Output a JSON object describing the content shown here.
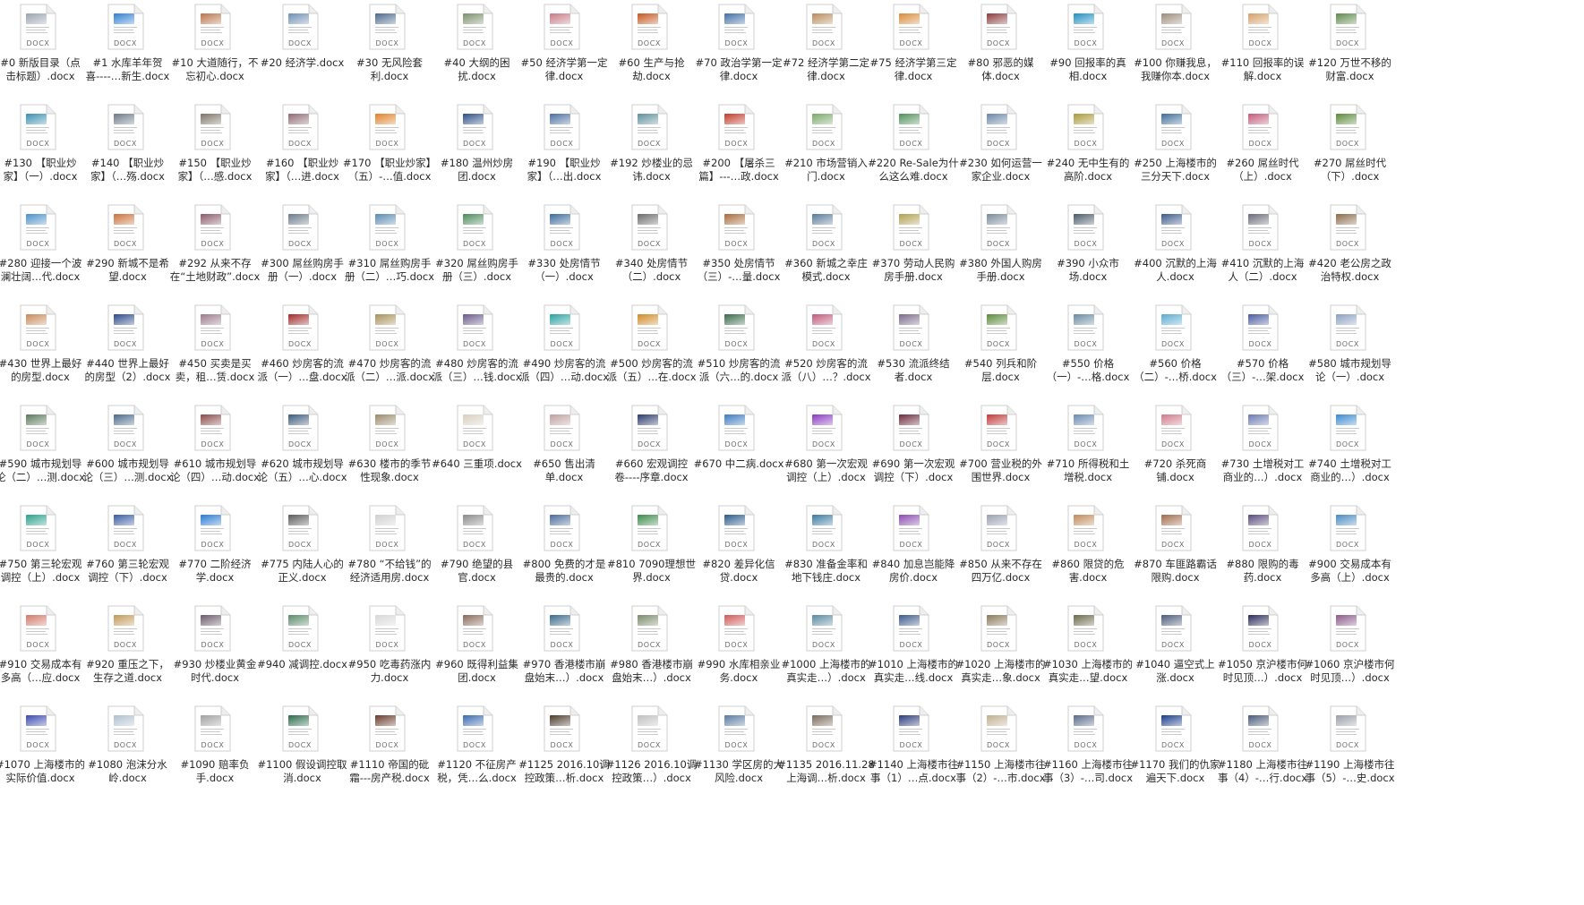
{
  "file_type_label": "DOCX",
  "files": [
    {
      "name": "#0 新版目录（点击标题）.docx",
      "l1": "#0 新版目录（点",
      "l2": "击标题）.docx",
      "thumb": "#9aa4b0"
    },
    {
      "name": "#1 水库羊年贺喜----…新生.docx",
      "l1": "#1 水库羊年贺",
      "l2": "喜----…新生.docx",
      "thumb": "#2f7fd1"
    },
    {
      "name": "#10 大道随行，不忘初心.docx",
      "l1": "#10 大道随行，不",
      "l2": "忘初心.docx",
      "thumb": "#b9754a"
    },
    {
      "name": "#20 经济学.docx",
      "l1": "#20 经济学.docx",
      "l2": "",
      "thumb": "#6f8fb4"
    },
    {
      "name": "#30 无风险套利.docx",
      "l1": "#30 无风险套",
      "l2": "利.docx",
      "thumb": "#4c6a8c"
    },
    {
      "name": "#40 大纲的困扰.docx",
      "l1": "#40 大纲的困",
      "l2": "扰.docx",
      "thumb": "#7a8f6a"
    },
    {
      "name": "#50 经济学第一定律.docx",
      "l1": "#50 经济学第一定",
      "l2": "律.docx",
      "thumb": "#c77a86"
    },
    {
      "name": "#60 生产与抢劫.docx",
      "l1": "#60 生产与抢",
      "l2": "劫.docx",
      "thumb": "#c4571f"
    },
    {
      "name": "#70 政治学第一定律.docx",
      "l1": "#70 政治学第一定",
      "l2": "律.docx",
      "thumb": "#3f6ea6"
    },
    {
      "name": "#72 经济学第二定律.docx",
      "l1": "#72 经济学第二定",
      "l2": "律.docx",
      "thumb": "#b88c5c"
    },
    {
      "name": "#75 经济学第三定律.docx",
      "l1": "#75 经济学第三定",
      "l2": "律.docx",
      "thumb": "#d98a3a"
    },
    {
      "name": "#80 邪恶的媒体.docx",
      "l1": "#80 邪恶的媒",
      "l2": "体.docx",
      "thumb": "#8c3b3b"
    },
    {
      "name": "#90 回报率的真相.docx",
      "l1": "#90 回报率的真",
      "l2": "相.docx",
      "thumb": "#1f8fc2"
    },
    {
      "name": "#100 你赚我息，我赚你本.docx",
      "l1": "#100 你赚我息，",
      "l2": "我赚你本.docx",
      "thumb": "#9c8c7a"
    },
    {
      "name": "#110 回报率的误解.docx",
      "l1": "#110 回报率的误",
      "l2": "解.docx",
      "thumb": "#d4a06a"
    },
    {
      "name": "#120 万世不移的财富.docx",
      "l1": "#120 万世不移的",
      "l2": "财富.docx",
      "thumb": "#5c8a4a"
    },
    {
      "name": "#130 【职业炒家】（一）.docx",
      "l1": "#130 【职业炒",
      "l2": "家】（一）.docx",
      "thumb": "#3a8fb0"
    },
    {
      "name": "#140 【职业炒家】（…殇.docx",
      "l1": "#140 【职业炒",
      "l2": "家】（…殇.docx",
      "thumb": "#6d7a88"
    },
    {
      "name": "#150 【职业炒家】（…感.docx",
      "l1": "#150 【职业炒",
      "l2": "家】（…感.docx",
      "thumb": "#7c7468"
    },
    {
      "name": "#160 【职业炒家】（…进.docx",
      "l1": "#160 【职业炒",
      "l2": "家】（…进.docx",
      "thumb": "#8f6a74"
    },
    {
      "name": "#170 【职业炒家】（五）-…值.docx",
      "l1": "#170 【职业炒家】",
      "l2": "（五）-…值.docx",
      "thumb": "#e0822a"
    },
    {
      "name": "#180 温州炒房团.docx",
      "l1": "#180 温州炒房",
      "l2": "团.docx",
      "thumb": "#2d4f86"
    },
    {
      "name": "#190 【职业炒家】（…出.docx",
      "l1": "#190 【职业炒",
      "l2": "家】（…出.docx",
      "thumb": "#4a6fa0"
    },
    {
      "name": "#192 炒楼业的忌讳.docx",
      "l1": "#192 炒楼业的忌",
      "l2": "讳.docx",
      "thumb": "#5d8f9a"
    },
    {
      "name": "#200 【屠杀三篇】---…政.docx",
      "l1": "#200 【屠杀三",
      "l2": "篇】---…政.docx",
      "thumb": "#c23a2a"
    },
    {
      "name": "#210 市场营销入门.docx",
      "l1": "#210 市场营销入",
      "l2": "门.docx",
      "thumb": "#7aa86a"
    },
    {
      "name": "#220 Re-Sale为什么这么难.docx",
      "l1": "#220 Re-Sale为什",
      "l2": "么这么难.docx",
      "thumb": "#4f8f5a"
    },
    {
      "name": "#230 如何运营一家企业.docx",
      "l1": "#230 如何运营一",
      "l2": "家企业.docx",
      "thumb": "#6b86a8"
    },
    {
      "name": "#240 无中生有的高阶.docx",
      "l1": "#240 无中生有的",
      "l2": "高阶.docx",
      "thumb": "#a89a3a"
    },
    {
      "name": "#250 上海楼市的三分天下.docx",
      "l1": "#250 上海楼市的",
      "l2": "三分天下.docx",
      "thumb": "#3d6d9a"
    },
    {
      "name": "#260 屌丝时代（上）.docx",
      "l1": "#260 屌丝时代",
      "l2": "（上）.docx",
      "thumb": "#c25a7a"
    },
    {
      "name": "#270 屌丝时代（下）.docx",
      "l1": "#270 屌丝时代",
      "l2": "（下）.docx",
      "thumb": "#5a8a3a"
    },
    {
      "name": "#280 迎接一个波澜壮阔…代.docx",
      "l1": "#280 迎接一个波",
      "l2": "澜壮阔…代.docx",
      "thumb": "#4a90c8"
    },
    {
      "name": "#290 新城不是希望.docx",
      "l1": "#290 新城不是希",
      "l2": "望.docx",
      "thumb": "#c9713a"
    },
    {
      "name": "#292 从来不存在“土地财政”.docx",
      "l1": "#292 从来不存",
      "l2": "在“土地财政”.docx",
      "thumb": "#8a5a6a"
    },
    {
      "name": "#300 屌丝购房手册（一）.docx",
      "l1": "#300 屌丝购房手",
      "l2": "册（一）.docx",
      "thumb": "#6a7a8a"
    },
    {
      "name": "#310 屌丝购房手册（二）…巧.docx",
      "l1": "#310 屌丝购房手",
      "l2": "册（二）…巧.docx",
      "thumb": "#5a8ab0"
    },
    {
      "name": "#320 屌丝购房手册（三）.docx",
      "l1": "#320 屌丝购房手",
      "l2": "册（三）.docx",
      "thumb": "#4a8a5a"
    },
    {
      "name": "#330 处房情节（一）.docx",
      "l1": "#330 处房情节",
      "l2": "（一）.docx",
      "thumb": "#3a6a9a"
    },
    {
      "name": "#340 处房情节（二）.docx",
      "l1": "#340 处房情节",
      "l2": "（二）.docx",
      "thumb": "#6a6a6a"
    },
    {
      "name": "#350 处房情节（三）-…量.docx",
      "l1": "#350 处房情节",
      "l2": "（三）-…量.docx",
      "thumb": "#a86a3a"
    },
    {
      "name": "#360 新城之幸庄模式.docx",
      "l1": "#360 新城之幸庄",
      "l2": "模式.docx",
      "thumb": "#5a7a9a"
    },
    {
      "name": "#370 劳动人民购房手册.docx",
      "l1": "#370 劳动人民购",
      "l2": "房手册.docx",
      "thumb": "#b0a050"
    },
    {
      "name": "#380 外国人购房手册.docx",
      "l1": "#380 外国人购房",
      "l2": "手册.docx",
      "thumb": "#7a8a9a"
    },
    {
      "name": "#390 小众市场.docx",
      "l1": "#390 小众市",
      "l2": "场.docx",
      "thumb": "#4a5a6a"
    },
    {
      "name": "#400 沉默的上海人.docx",
      "l1": "#400 沉默的上海",
      "l2": "人.docx",
      "thumb": "#3a5a8a"
    },
    {
      "name": "#410 沉默的上海人（二）.docx",
      "l1": "#410 沉默的上海",
      "l2": "人（二）.docx",
      "thumb": "#6a6a7a"
    },
    {
      "name": "#420 老公房之政治特权.docx",
      "l1": "#420 老公房之政",
      "l2": "治特权.docx",
      "thumb": "#8a6a4a"
    },
    {
      "name": "#430 世界上最好的房型.docx",
      "l1": "#430 世界上最好",
      "l2": "的房型.docx",
      "thumb": "#c88a5a"
    },
    {
      "name": "#440 世界上最好的房型（2）.docx",
      "l1": "#440 世界上最好",
      "l2": "的房型（2）.docx",
      "thumb": "#2a4a8a"
    },
    {
      "name": "#450 买卖是买卖，租…赁.docx",
      "l1": "#450 买卖是买",
      "l2": "卖，租…赁.docx",
      "thumb": "#9a7a8a"
    },
    {
      "name": "#460 炒房客的流派（一）…盘.docx",
      "l1": "#460 炒房客的流",
      "l2": "派（一）…盘.docx",
      "thumb": "#a02a2a"
    },
    {
      "name": "#470 炒房客的流派（二）…派.docx",
      "l1": "#470 炒房客的流",
      "l2": "派（二）…派.docx",
      "thumb": "#a8905a"
    },
    {
      "name": "#480 炒房客的流派（三）…钱.docx",
      "l1": "#480 炒房客的流",
      "l2": "派（三）…钱.docx",
      "thumb": "#6a5a8a"
    },
    {
      "name": "#490 炒房客的流派（四）…动.docx",
      "l1": "#490 炒房客的流",
      "l2": "派（四）…动.docx",
      "thumb": "#2aa0a0"
    },
    {
      "name": "#500 炒房客的流派（五）…在.docx",
      "l1": "#500 炒房客的流",
      "l2": "派（五）…在.docx",
      "thumb": "#d08a2a"
    },
    {
      "name": "#510 炒房客的流派（六…的.docx",
      "l1": "#510 炒房客的流",
      "l2": "派（六…的.docx",
      "thumb": "#3a6a4a"
    },
    {
      "name": "#520 炒房客的流派（八）…？.docx",
      "l1": "#520 炒房客的流",
      "l2": "派（八）…？.docx",
      "thumb": "#c05a7a"
    },
    {
      "name": "#530 流派终结者.docx",
      "l1": "#530 流派终结",
      "l2": "者.docx",
      "thumb": "#7a6a8a"
    },
    {
      "name": "#540 列兵和阶层.docx",
      "l1": "#540 列兵和阶",
      "l2": "层.docx",
      "thumb": "#5a8a3a"
    },
    {
      "name": "#550 价格（一）-…格.docx",
      "l1": "#550 价格",
      "l2": "（一）-…格.docx",
      "thumb": "#6a8aa0"
    },
    {
      "name": "#560 价格（二）-…桥.docx",
      "l1": "#560 价格",
      "l2": "（二）-…桥.docx",
      "thumb": "#5aaad0"
    },
    {
      "name": "#570 价格（三）-…架.docx",
      "l1": "#570 价格",
      "l2": "（三）-…架.docx",
      "thumb": "#4a5aa0"
    },
    {
      "name": "#580 城市规划导论（一）.docx",
      "l1": "#580 城市规划导",
      "l2": "论（一）.docx",
      "thumb": "#8aa0c0"
    },
    {
      "name": "#590 城市规划导论（二）…测.docx",
      "l1": "#590 城市规划导",
      "l2": "论（二）…测.docx",
      "thumb": "#5a7a5a"
    },
    {
      "name": "#600 城市规划导论（三）…测.docx",
      "l1": "#600 城市规划导",
      "l2": "论（三）…测.docx",
      "thumb": "#4a6a8a"
    },
    {
      "name": "#610 城市规划导论（四）…动.docx",
      "l1": "#610 城市规划导",
      "l2": "论（四）…动.docx",
      "thumb": "#8a4a4a"
    },
    {
      "name": "#620 城市规划导论（五）…心.docx",
      "l1": "#620 城市规划导",
      "l2": "论（五）…心.docx",
      "thumb": "#3a5a7a"
    },
    {
      "name": "#630 楼市的季节性现象.docx",
      "l1": "#630 楼市的季节",
      "l2": "性现象.docx",
      "thumb": "#9a8a6a"
    },
    {
      "name": "#640 三重项.docx",
      "l1": "#640 三重项.docx",
      "l2": "",
      "thumb": "#d8d0c0"
    },
    {
      "name": "#650 售出清单.docx",
      "l1": "#650 售出清",
      "l2": "单.docx",
      "thumb": "#c0a0a0"
    },
    {
      "name": "#660 宏观调控卷----序章.docx",
      "l1": "#660 宏观调控",
      "l2": "卷----序章.docx",
      "thumb": "#2a3a6a"
    },
    {
      "name": "#670 中二病.docx",
      "l1": "#670 中二病.docx",
      "l2": "",
      "thumb": "#3a7ac0"
    },
    {
      "name": "#680 第一次宏观调控（上）.docx",
      "l1": "#680 第一次宏观",
      "l2": "调控（上）.docx",
      "thumb": "#8a3ac0"
    },
    {
      "name": "#690 第一次宏观调控（下）.docx",
      "l1": "#690 第一次宏观",
      "l2": "调控（下）.docx",
      "thumb": "#6a2a3a"
    },
    {
      "name": "#700 营业税的外围世界.docx",
      "l1": "#700 营业税的外",
      "l2": "围世界.docx",
      "thumb": "#c03a3a"
    },
    {
      "name": "#710 所得税和土增税.docx",
      "l1": "#710 所得税和土",
      "l2": "增税.docx",
      "thumb": "#6a8ab0"
    },
    {
      "name": "#720 杀死商铺.docx",
      "l1": "#720 杀死商",
      "l2": "铺.docx",
      "thumb": "#d07a8a"
    },
    {
      "name": "#730 土增税对工商业的…).docx",
      "l1": "#730 土增税对工",
      "l2": "商业的…）.docx",
      "thumb": "#6a7ab0"
    },
    {
      "name": "#740 土增税对工商业的…).docx",
      "l1": "#740 土增税对工",
      "l2": "商业的…）.docx",
      "thumb": "#3a8ad0"
    },
    {
      "name": "#750 第三轮宏观调控（上）.docx",
      "l1": "#750 第三轮宏观",
      "l2": "调控（上）.docx",
      "thumb": "#2aa08a"
    },
    {
      "name": "#760 第三轮宏观调控（下）.docx",
      "l1": "#760 第三轮宏观",
      "l2": "调控（下）.docx",
      "thumb": "#3a5aa0"
    },
    {
      "name": "#770 二阶经济学.docx",
      "l1": "#770 二阶经济",
      "l2": "学.docx",
      "thumb": "#2a7ad0"
    },
    {
      "name": "#775 内陆人心的正义.docx",
      "l1": "#775 内陆人心的",
      "l2": "正义.docx",
      "thumb": "#5a5a5a"
    },
    {
      "name": "#780 “不给钱”的经济适用房.docx",
      "l1": "#780 “不给钱”的",
      "l2": "经济适用房.docx",
      "thumb": "#d0d0d0"
    },
    {
      "name": "#790 绝望的县官.docx",
      "l1": "#790 绝望的县",
      "l2": "官.docx",
      "thumb": "#8a8a8a"
    },
    {
      "name": "#800 免费的才是最贵的.docx",
      "l1": "#800 免费的才是",
      "l2": "最贵的.docx",
      "thumb": "#4a6a9a"
    },
    {
      "name": "#810 7090理想世界.docx",
      "l1": "#810 7090理想世",
      "l2": "界.docx",
      "thumb": "#3a8a4a"
    },
    {
      "name": "#820 差异化信贷.docx",
      "l1": "#820 差异化信",
      "l2": "贷.docx",
      "thumb": "#2a5a8a"
    },
    {
      "name": "#830 准备金率和地下钱庄.docx",
      "l1": "#830 准备金率和",
      "l2": "地下钱庄.docx",
      "thumb": "#3a7aa0"
    },
    {
      "name": "#840 加息岂能降房价.docx",
      "l1": "#840 加息岂能降",
      "l2": "房价.docx",
      "thumb": "#8a4ab0"
    },
    {
      "name": "#850 从来不存在四万亿.docx",
      "l1": "#850 从来不存在",
      "l2": "四万亿.docx",
      "thumb": "#9aa0b0"
    },
    {
      "name": "#860 限贷的危害.docx",
      "l1": "#860 限贷的危",
      "l2": "害.docx",
      "thumb": "#c08a5a"
    },
    {
      "name": "#870 车匪路霸话限购.docx",
      "l1": "#870 车匪路霸话",
      "l2": "限购.docx",
      "thumb": "#a06a4a"
    },
    {
      "name": "#880 限购的毒药.docx",
      "l1": "#880 限购的毒",
      "l2": "药.docx",
      "thumb": "#5a4a7a"
    },
    {
      "name": "#900 交易成本有多高（上）.docx",
      "l1": "#900 交易成本有",
      "l2": "多高（上）.docx",
      "thumb": "#4a8ac0"
    },
    {
      "name": "#910 交易成本有多高（…应.docx",
      "l1": "#910 交易成本有",
      "l2": "多高（…应.docx",
      "thumb": "#d07a6a"
    },
    {
      "name": "#920 重压之下，生存之道.docx",
      "l1": "#920 重压之下，",
      "l2": "生存之道.docx",
      "thumb": "#c09a5a"
    },
    {
      "name": "#930 炒楼业黄金时代.docx",
      "l1": "#930 炒楼业黄金",
      "l2": "时代.docx",
      "thumb": "#6a5a6a"
    },
    {
      "name": "#940 减调控.docx",
      "l1": "#940 减调控.docx",
      "l2": "",
      "thumb": "#5a8a6a"
    },
    {
      "name": "#950 吃毒药涨内力.docx",
      "l1": "#950 吃毒药涨内",
      "l2": "力.docx",
      "thumb": "#d8d8d8"
    },
    {
      "name": "#960 既得利益集团.docx",
      "l1": "#960 既得利益集",
      "l2": "团.docx",
      "thumb": "#8a6a5a"
    },
    {
      "name": "#970 香港楼市崩盘始末…).docx",
      "l1": "#970 香港楼市崩",
      "l2": "盘始末…）.docx",
      "thumb": "#3a6a8a"
    },
    {
      "name": "#980 香港楼市崩盘始末…).docx",
      "l1": "#980 香港楼市崩",
      "l2": "盘始末…）.docx",
      "thumb": "#7a8a6a"
    },
    {
      "name": "#990 水库相亲业务.docx",
      "l1": "#990 水库相亲业",
      "l2": "务.docx",
      "thumb": "#d05a5a"
    },
    {
      "name": "#1000 上海楼市的真实走…).docx",
      "l1": "#1000 上海楼市的",
      "l2": "真实走…）.docx",
      "thumb": "#5a8aa0"
    },
    {
      "name": "#1010 上海楼市的真实走…线.docx",
      "l1": "#1010 上海楼市的",
      "l2": "真实走…线.docx",
      "thumb": "#3a5a8a"
    },
    {
      "name": "#1020 上海楼市的真实走…象.docx",
      "l1": "#1020 上海楼市的",
      "l2": "真实走…象.docx",
      "thumb": "#8a7a5a"
    },
    {
      "name": "#1030 上海楼市的真实走…望.docx",
      "l1": "#1030 上海楼市的",
      "l2": "真实走…望.docx",
      "thumb": "#6a6a4a"
    },
    {
      "name": "#1040 逼空式上涨.docx",
      "l1": "#1040 逼空式上",
      "l2": "涨.docx",
      "thumb": "#4a5a7a"
    },
    {
      "name": "#1050 京沪楼市何时见顶…).docx",
      "l1": "#1050 京沪楼市何",
      "l2": "时见顶…）.docx",
      "thumb": "#2a2a5a"
    },
    {
      "name": "#1060 京沪楼市何时见顶…).docx",
      "l1": "#1060 京沪楼市何",
      "l2": "时见顶…）.docx",
      "thumb": "#8a5a8a"
    },
    {
      "name": "#1070 上海楼市的实际价值.docx",
      "l1": "#1070 上海楼市的",
      "l2": "实际价值.docx",
      "thumb": "#3a4ab0"
    },
    {
      "name": "#1080 泡沫分水岭.docx",
      "l1": "#1080 泡沫分水",
      "l2": "岭.docx",
      "thumb": "#b0c0d0"
    },
    {
      "name": "#1090 赔率负手.docx",
      "l1": "#1090 赔率负",
      "l2": "手.docx",
      "thumb": "#a0a0a0"
    },
    {
      "name": "#1100 假设调控取消.docx",
      "l1": "#1100 假设调控取",
      "l2": "消.docx",
      "thumb": "#2a6a4a"
    },
    {
      "name": "#1110 帝国的砒霜---房产税.docx",
      "l1": "#1110 帝国的砒",
      "l2": "霜---房产税.docx",
      "thumb": "#6a3a2a"
    },
    {
      "name": "#1120 不征房产税，凭…么.docx",
      "l1": "#1120 不征房产",
      "l2": "税，凭…么.docx",
      "thumb": "#3a6ab0"
    },
    {
      "name": "#1125 2016.10调控政策…析.docx",
      "l1": "#1125 2016.10调",
      "l2": "控政策…析.docx",
      "thumb": "#4a3a2a"
    },
    {
      "name": "#1126 2016.10调控政策…).docx",
      "l1": "#1126 2016.10调",
      "l2": "控政策…）.docx",
      "thumb": "#c0c0c0"
    },
    {
      "name": "#1130 学区房的大风险.docx",
      "l1": "#1130 学区房的大",
      "l2": "风险.docx",
      "thumb": "#5a7aa0"
    },
    {
      "name": "#1135 2016.11.28上海调…析.docx",
      "l1": "#1135 2016.11.28",
      "l2": "上海调…析.docx",
      "thumb": "#7a6a5a"
    },
    {
      "name": "#1140 上海楼市往事（1）…点.docx",
      "l1": "#1140 上海楼市往",
      "l2": "事（1）…点.docx",
      "thumb": "#2a3a7a"
    },
    {
      "name": "#1150 上海楼市往事（2）-…市.docx",
      "l1": "#1150 上海楼市往",
      "l2": "事（2）-…市.docx",
      "thumb": "#c0b090"
    },
    {
      "name": "#1160 上海楼市往事（3）-…司.docx",
      "l1": "#1160 上海楼市往",
      "l2": "事（3）-…司.docx",
      "thumb": "#5a6a8a"
    },
    {
      "name": "#1170 我们的仇家遍天下.docx",
      "l1": "#1170 我们的仇家",
      "l2": "遍天下.docx",
      "thumb": "#1a3a8a"
    },
    {
      "name": "#1180 上海楼市往事（4）-…行.docx",
      "l1": "#1180 上海楼市往",
      "l2": "事（4）-…行.docx",
      "thumb": "#4a5a7a"
    },
    {
      "name": "#1190 上海楼市往事（5）-…史.docx",
      "l1": "#1190 上海楼市往",
      "l2": "事（5）-…史.docx",
      "thumb": "#9aa0a8"
    }
  ]
}
